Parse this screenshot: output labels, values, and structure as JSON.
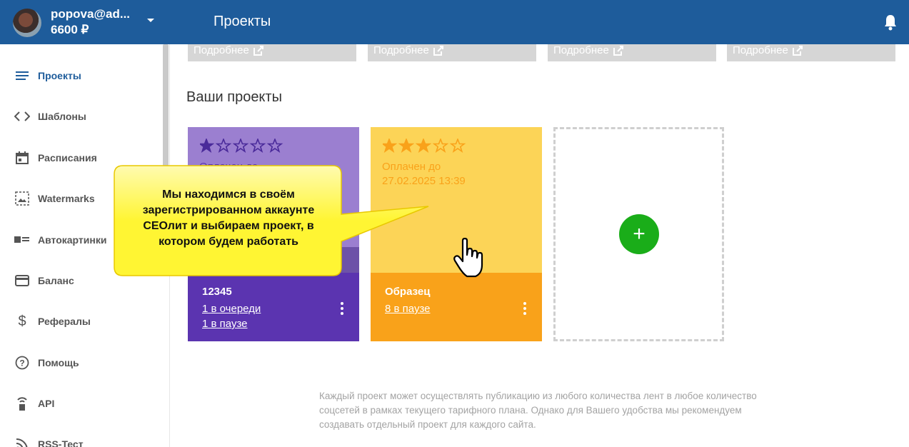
{
  "header": {
    "user_email": "popova@ad...",
    "user_balance": "6600 ₽",
    "page_title": "Проекты"
  },
  "sidebar": {
    "items": [
      {
        "label": "Проекты",
        "icon": "list-icon"
      },
      {
        "label": "Шаблоны",
        "icon": "code-icon"
      },
      {
        "label": "Расписания",
        "icon": "calendar-icon"
      },
      {
        "label": "Watermarks",
        "icon": "image-icon"
      },
      {
        "label": "Автокартинки",
        "icon": "image-text-icon"
      },
      {
        "label": "Баланс",
        "icon": "credit-card-icon"
      },
      {
        "label": "Рефералы",
        "icon": "dollar-icon"
      },
      {
        "label": "Помощь",
        "icon": "help-icon"
      },
      {
        "label": "API",
        "icon": "api-icon"
      },
      {
        "label": "RSS-Тест",
        "icon": "rss-icon"
      }
    ]
  },
  "top_cards": {
    "link_label": "Подробнее"
  },
  "section_title": "Ваши проекты",
  "projects": [
    {
      "rating": 1.5,
      "paid_label": "Оплачен до",
      "name": "12345",
      "link1": "1 в очереди",
      "link2": "1 в паузе",
      "accent": "#5b34b0"
    },
    {
      "rating": 3.5,
      "paid_label": "Оплачен до",
      "paid_date": "27.02.2025 13:39",
      "name": "Образец",
      "link1": "8 в паузе",
      "accent": "#f9a21a"
    }
  ],
  "add_project_label": "+",
  "callout": {
    "line1": "Мы находимся в своём",
    "line2": "зарегистрированном аккаунте",
    "line3": "СЕОлит и выбираем проект, в",
    "line4": "котором будем работать"
  },
  "footer_note": {
    "line1": "Каждый проект может осуществлять публикацию из любого количества лент в любое количество",
    "line2": "соцсетей в рамках текущего тарифного плана. Однако для Вашего удобства мы рекомендуем",
    "line3": "создавать отдельный проект для каждого сайта."
  },
  "colors": {
    "header_bg": "#1e5c9b",
    "add_button": "#1aad19",
    "callout_fill": "#fff533"
  }
}
